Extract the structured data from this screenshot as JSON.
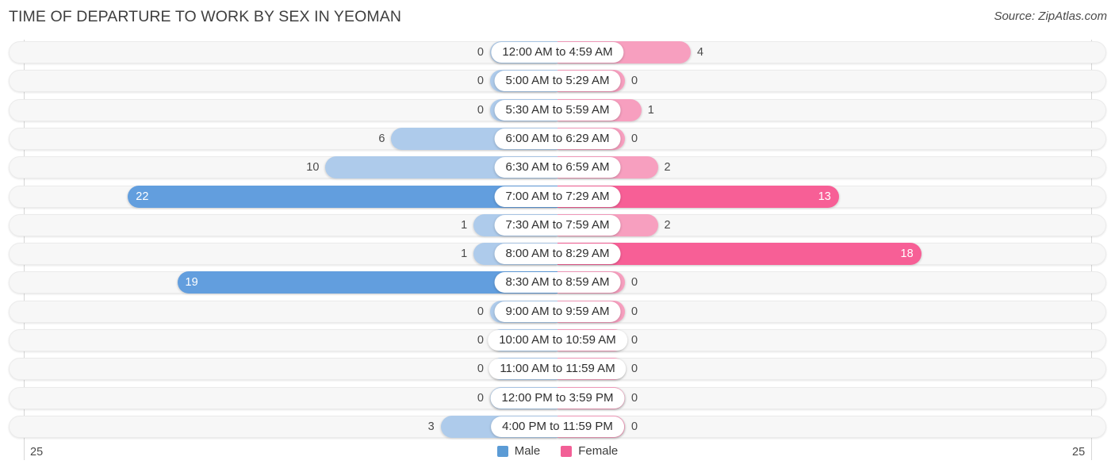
{
  "header": {
    "title": "TIME OF DEPARTURE TO WORK BY SEX IN YEOMAN",
    "source": "Source: ZipAtlas.com"
  },
  "axis": {
    "left_label": "25",
    "right_label": "25"
  },
  "legend": {
    "items": [
      {
        "label": "Male",
        "color": "#5b9bd5"
      },
      {
        "label": "Female",
        "color": "#f25f96"
      }
    ]
  },
  "colors": {
    "male_strong": "#629ede",
    "male_light": "#aecbeb",
    "female_strong": "#f75f96",
    "female_light": "#f79fbf",
    "track": "#f7f7f7",
    "gridline": "#d7d7d7"
  },
  "chart_data": {
    "type": "bar",
    "title": "TIME OF DEPARTURE TO WORK BY SEX IN YEOMAN",
    "subtitle": "Source: ZipAtlas.com",
    "orientation": "horizontal-diverging",
    "xlabel": "",
    "ylabel": "",
    "xlim": [
      25,
      25
    ],
    "axis_left_max": 25,
    "axis_right_max": 25,
    "grid": true,
    "legend_position": "bottom-center",
    "categories": [
      "12:00 AM to 4:59 AM",
      "5:00 AM to 5:29 AM",
      "5:30 AM to 5:59 AM",
      "6:00 AM to 6:29 AM",
      "6:30 AM to 6:59 AM",
      "7:00 AM to 7:29 AM",
      "7:30 AM to 7:59 AM",
      "8:00 AM to 8:29 AM",
      "8:30 AM to 8:59 AM",
      "9:00 AM to 9:59 AM",
      "10:00 AM to 10:59 AM",
      "11:00 AM to 11:59 AM",
      "12:00 PM to 3:59 PM",
      "4:00 PM to 11:59 PM"
    ],
    "series": [
      {
        "name": "Male",
        "values": [
          0,
          0,
          0,
          6,
          10,
          22,
          1,
          1,
          19,
          0,
          0,
          0,
          0,
          3
        ]
      },
      {
        "name": "Female",
        "values": [
          4,
          0,
          1,
          0,
          2,
          13,
          2,
          18,
          0,
          0,
          0,
          0,
          0,
          0
        ]
      }
    ]
  },
  "rows": [
    {
      "label": "12:00 AM to 4:59 AM",
      "male": "0",
      "female": "4"
    },
    {
      "label": "5:00 AM to 5:29 AM",
      "male": "0",
      "female": "0"
    },
    {
      "label": "5:30 AM to 5:59 AM",
      "male": "0",
      "female": "1"
    },
    {
      "label": "6:00 AM to 6:29 AM",
      "male": "6",
      "female": "0"
    },
    {
      "label": "6:30 AM to 6:59 AM",
      "male": "10",
      "female": "2"
    },
    {
      "label": "7:00 AM to 7:29 AM",
      "male": "22",
      "female": "13"
    },
    {
      "label": "7:30 AM to 7:59 AM",
      "male": "1",
      "female": "2"
    },
    {
      "label": "8:00 AM to 8:29 AM",
      "male": "1",
      "female": "18"
    },
    {
      "label": "8:30 AM to 8:59 AM",
      "male": "19",
      "female": "0"
    },
    {
      "label": "9:00 AM to 9:59 AM",
      "male": "0",
      "female": "0"
    },
    {
      "label": "10:00 AM to 10:59 AM",
      "male": "0",
      "female": "0"
    },
    {
      "label": "11:00 AM to 11:59 AM",
      "male": "0",
      "female": "0"
    },
    {
      "label": "12:00 PM to 3:59 PM",
      "male": "0",
      "female": "0"
    },
    {
      "label": "4:00 PM to 11:59 PM",
      "male": "3",
      "female": "0"
    }
  ]
}
